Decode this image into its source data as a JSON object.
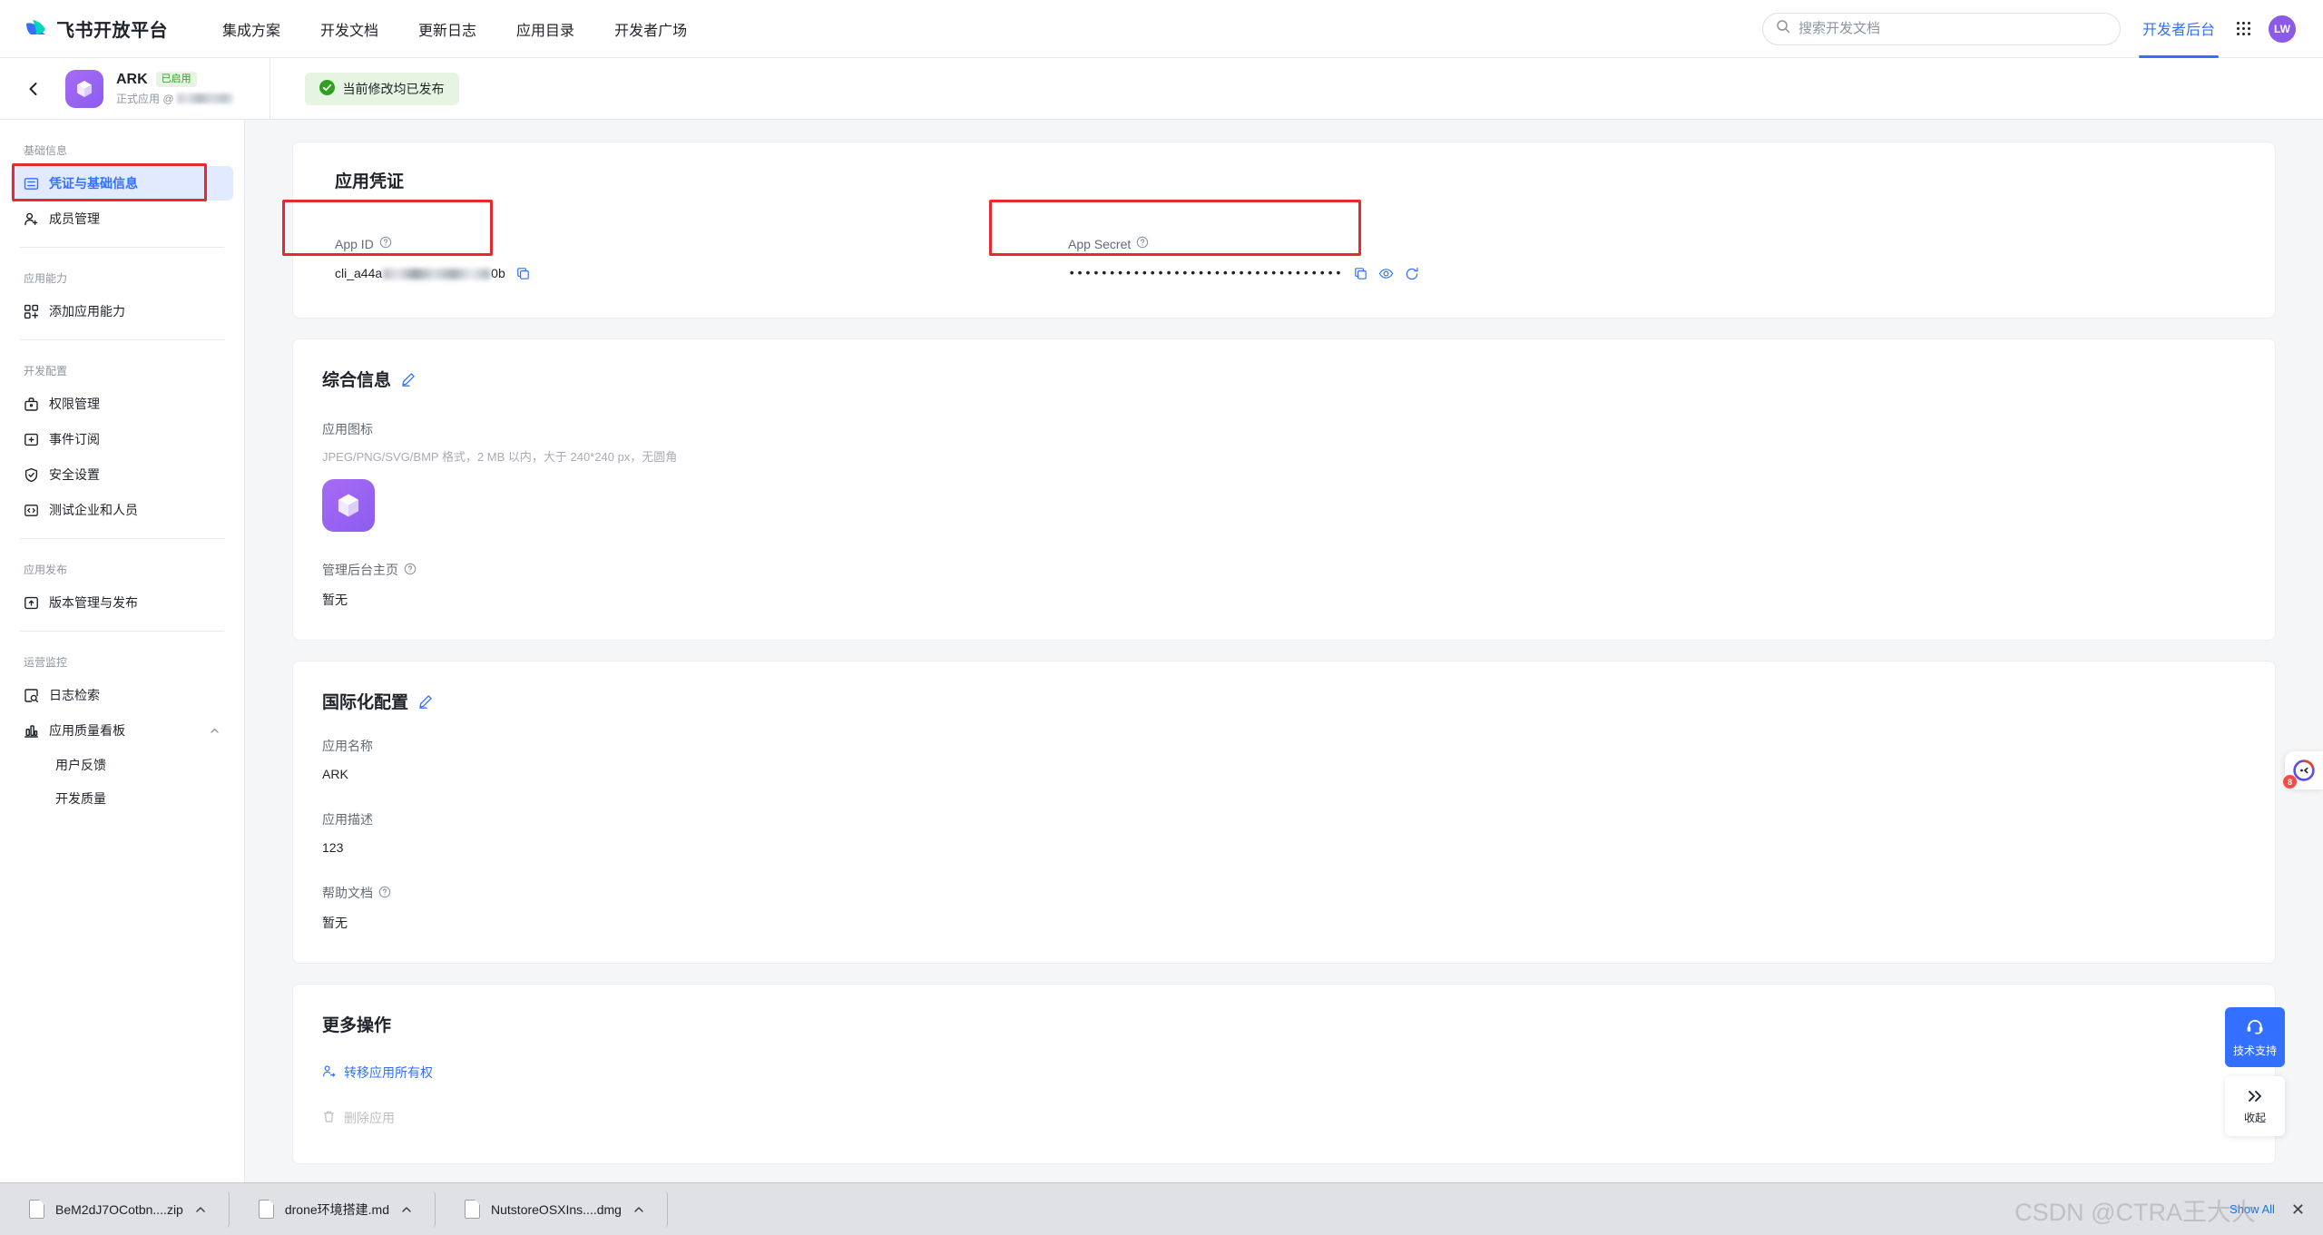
{
  "topnav": {
    "brand": "飞书开放平台",
    "links": [
      "集成方案",
      "开发文档",
      "更新日志",
      "应用目录",
      "开发者广场"
    ],
    "search_placeholder": "搜索开发文档",
    "dev_console": "开发者后台",
    "avatar_initials": "LW",
    "accent_color": "#3370ff"
  },
  "appbar": {
    "app_name": "ARK",
    "status_badge": "已启用",
    "subtitle_prefix": "正式应用 @",
    "publish_status": "当前修改均已发布",
    "publish_bg": "#e5f5e2",
    "publish_color": "#2ea121"
  },
  "sidebar": {
    "groups": [
      {
        "label": "基础信息",
        "items": [
          {
            "label": "凭证与基础信息",
            "icon": "credential-icon",
            "active": true
          },
          {
            "label": "成员管理",
            "icon": "member-icon",
            "active": false
          }
        ]
      },
      {
        "label": "应用能力",
        "items": [
          {
            "label": "添加应用能力",
            "icon": "capability-icon",
            "active": false
          }
        ]
      },
      {
        "label": "开发配置",
        "items": [
          {
            "label": "权限管理",
            "icon": "permission-icon",
            "active": false
          },
          {
            "label": "事件订阅",
            "icon": "event-icon",
            "active": false
          },
          {
            "label": "安全设置",
            "icon": "shield-icon",
            "active": false
          },
          {
            "label": "测试企业和人员",
            "icon": "code-icon",
            "active": false
          }
        ]
      },
      {
        "label": "应用发布",
        "items": [
          {
            "label": "版本管理与发布",
            "icon": "publish-icon",
            "active": false
          }
        ]
      },
      {
        "label": "运营监控",
        "items": [
          {
            "label": "日志检索",
            "icon": "log-search-icon",
            "active": false
          },
          {
            "label": "应用质量看板",
            "icon": "chart-icon",
            "active": false,
            "expandable": true
          }
        ],
        "subitems": [
          "用户反馈",
          "开发质量"
        ]
      }
    ]
  },
  "credentials": {
    "title": "应用凭证",
    "app_id_label": "App ID",
    "app_id_prefix": "cli_a44a",
    "app_id_suffix": "0b",
    "app_secret_label": "App Secret",
    "app_secret_value": "••••••••••••••••••••••••••••••••••"
  },
  "general": {
    "title": "综合信息",
    "icon_label": "应用图标",
    "icon_hint": "JPEG/PNG/SVG/BMP 格式，2 MB 以内，大于 240*240 px，无圆角",
    "admin_home_label": "管理后台主页",
    "admin_home_value": "暂无"
  },
  "i18n": {
    "title": "国际化配置",
    "name_label": "应用名称",
    "name_value": "ARK",
    "desc_label": "应用描述",
    "desc_value": "123",
    "help_label": "帮助文档",
    "help_value": "暂无"
  },
  "more_ops": {
    "title": "更多操作",
    "transfer_label": "转移应用所有权",
    "delete_label": "删除应用"
  },
  "floating": {
    "chat_badge": "8",
    "support_label": "技术支持",
    "collapse_label": "收起"
  },
  "downloads": {
    "items": [
      {
        "name": "BeM2dJ7OCotbn....zip"
      },
      {
        "name": "drone环境搭建.md"
      },
      {
        "name": "NutstoreOSXIns....dmg"
      }
    ],
    "show_all": "Show All",
    "watermark": "CSDN @CTRA王大大"
  }
}
